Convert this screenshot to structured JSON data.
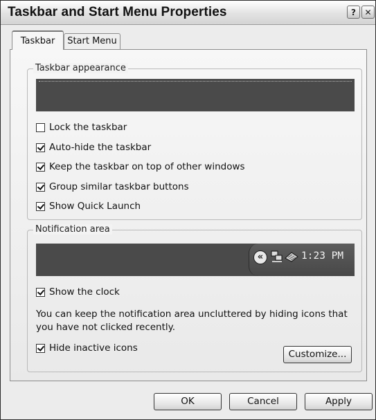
{
  "window": {
    "title": "Taskbar and Start Menu Properties",
    "help_glyph": "?",
    "close_glyph": "✕"
  },
  "tabs": [
    {
      "label": "Taskbar",
      "active": true
    },
    {
      "label": "Start Menu",
      "active": false
    }
  ],
  "taskbar_appearance": {
    "group_label": "Taskbar appearance",
    "options": [
      {
        "label": "Lock the taskbar",
        "checked": false
      },
      {
        "label": "Auto-hide the taskbar",
        "checked": true
      },
      {
        "label": "Keep the taskbar on top of other windows",
        "checked": true
      },
      {
        "label": "Group similar taskbar buttons",
        "checked": true
      },
      {
        "label": "Show Quick Launch",
        "checked": true
      }
    ]
  },
  "notification_area": {
    "group_label": "Notification area",
    "clock_text": "1:23 PM",
    "tray_icons": [
      "show-hidden-icons-chevron-icon",
      "network-icon",
      "app-icon"
    ],
    "show_clock": {
      "label": "Show the clock",
      "checked": true
    },
    "info": "You can keep the notification area uncluttered by hiding icons that you have not clicked recently.",
    "hide_inactive": {
      "label": "Hide inactive icons",
      "checked": true
    },
    "customize_label": "Customize..."
  },
  "buttons": {
    "ok": "OK",
    "cancel": "Cancel",
    "apply": "Apply"
  },
  "colors": {
    "preview_bar": "#4a4a4a",
    "panel_bg": "#ececec"
  }
}
